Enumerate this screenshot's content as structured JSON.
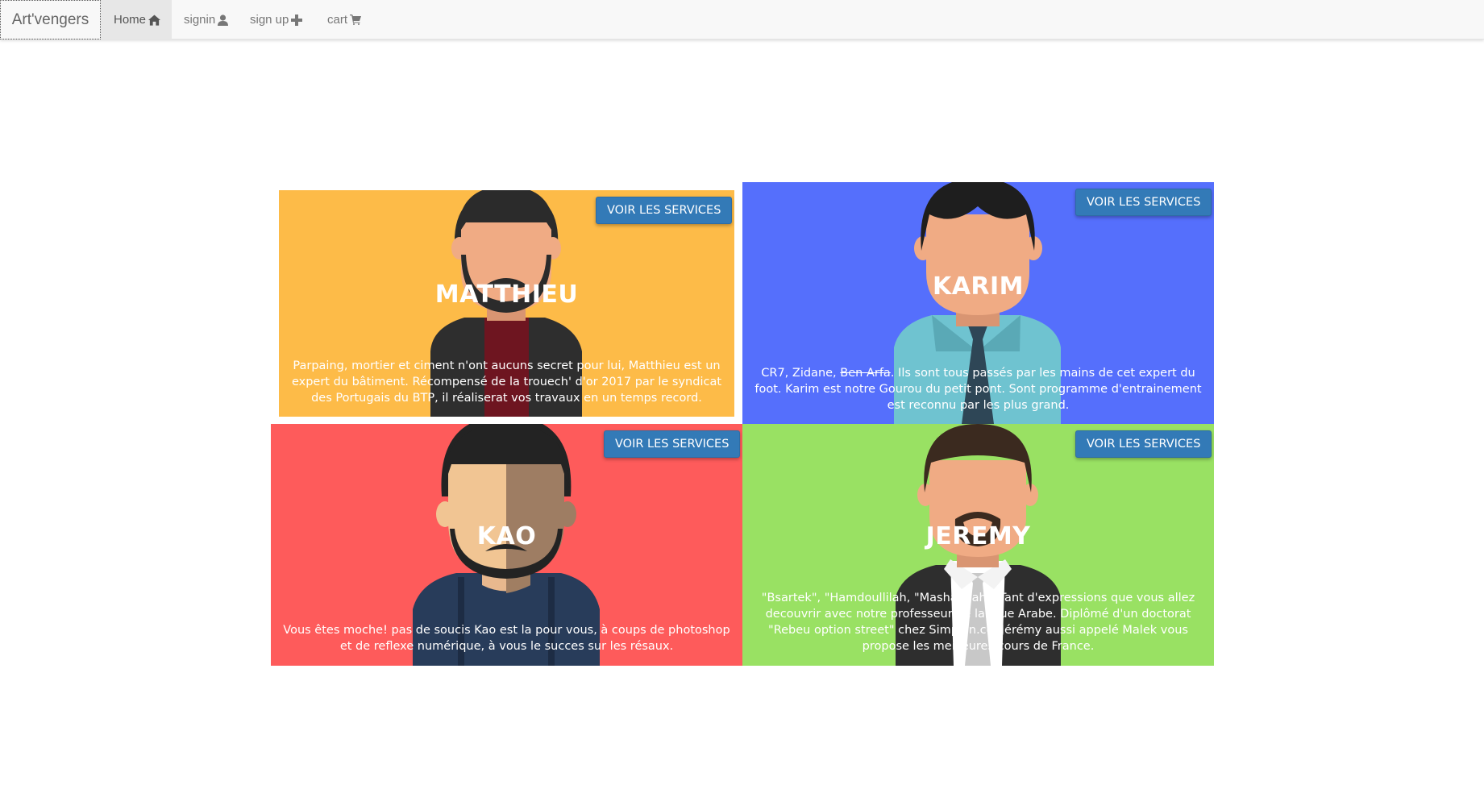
{
  "navbar": {
    "brand": "Art'vengers",
    "items": [
      {
        "label": "Home",
        "icon": "home-icon",
        "active": true
      },
      {
        "label": "signin",
        "icon": "user-icon",
        "active": false
      },
      {
        "label": "sign up",
        "icon": "plus-icon",
        "active": false
      },
      {
        "label": "cart",
        "icon": "cart-icon",
        "active": false
      }
    ]
  },
  "cards": {
    "matthieu": {
      "name": "MATTHIEU",
      "button": "VOIR LES SERVICES",
      "description": "Parpaing, mortier et ciment n'ont aucuns secret pour lui, Matthieu est un expert du bâtiment. Récompensé de la trouech' d'or 2017 par le syndicat des Portugais du BTP, il réaliserat vos travaux en un temps record.",
      "bg_color": "#fdbb48"
    },
    "karim": {
      "name": "KARIM",
      "button": "VOIR LES SERVICES",
      "description_pre": "CR7, Zidane, ",
      "description_strike": "Ben Arfa",
      "description_post": ". Ils sont tous passés par les mains de cet expert du foot. Karim est notre Gourou du petit pont. Sont programme d'entrainement est reconnu par les plus grand.",
      "bg_color": "#556ffc"
    },
    "kao": {
      "name": "KAO",
      "button": "VOIR LES SERVICES",
      "description": "Vous êtes moche! pas de soucis Kao est la pour vous, à coups de photoshop et de reflexe numérique, à vous le succes sur les résaux.",
      "bg_color": "#fe5b5b"
    },
    "jeremy": {
      "name": "JEREMY",
      "button": "VOIR LES SERVICES",
      "description": "\"Bsartek\", \"Hamdoullilah, \"MashaAllah\", Tant d'expressions que vous allez decouvrir avec notre professeur de langue Arabe. Diplômé d'un doctorat \"Rebeu option street\" chez Simplon.co, Jérémy aussi appelé Malek vous propose les meilleures cours de France.",
      "bg_color": "#99e163"
    }
  },
  "button_color": "#337ab7"
}
